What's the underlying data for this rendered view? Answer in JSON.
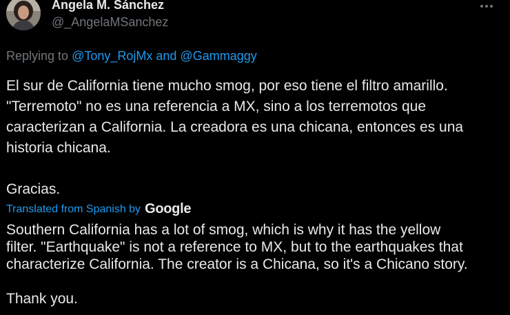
{
  "author": {
    "display_name": "Angela M. Sánchez",
    "handle": "@_AngelaMSanchez",
    "avatar_icon": "user-avatar"
  },
  "header": {
    "more_icon": "more-horizontal-icon",
    "more_glyph": "•••"
  },
  "reply_context": {
    "prefix": "Replying to ",
    "mention_1": "@Tony_RojMx",
    "connector": " and ",
    "mention_2": "@Gammaggy"
  },
  "tweet": {
    "original_text": "El sur de California tiene mucho smog, por eso tiene el filtro amarillo.\n\"Terremoto\" no es una referencia a MX, sino a los terremotos que\ncaracterizan a California. La creadora es una chicana, entonces es una\nhistoria chicana.\n\nGracias.",
    "translated_by_label": "Translated from Spanish by",
    "translator": "Google",
    "translated_text": "Southern California has a lot of smog, which is why it has the yellow\nfilter. \"Earthquake\" is not a reference to MX, but to the earthquakes that\ncharacterize California. The creator is a Chicana, so it's a Chicano story.\n\nThank you."
  },
  "colors": {
    "background": "#000000",
    "text_primary": "#e7e9ea",
    "text_secondary": "#71767b",
    "link": "#1d9bf0"
  }
}
